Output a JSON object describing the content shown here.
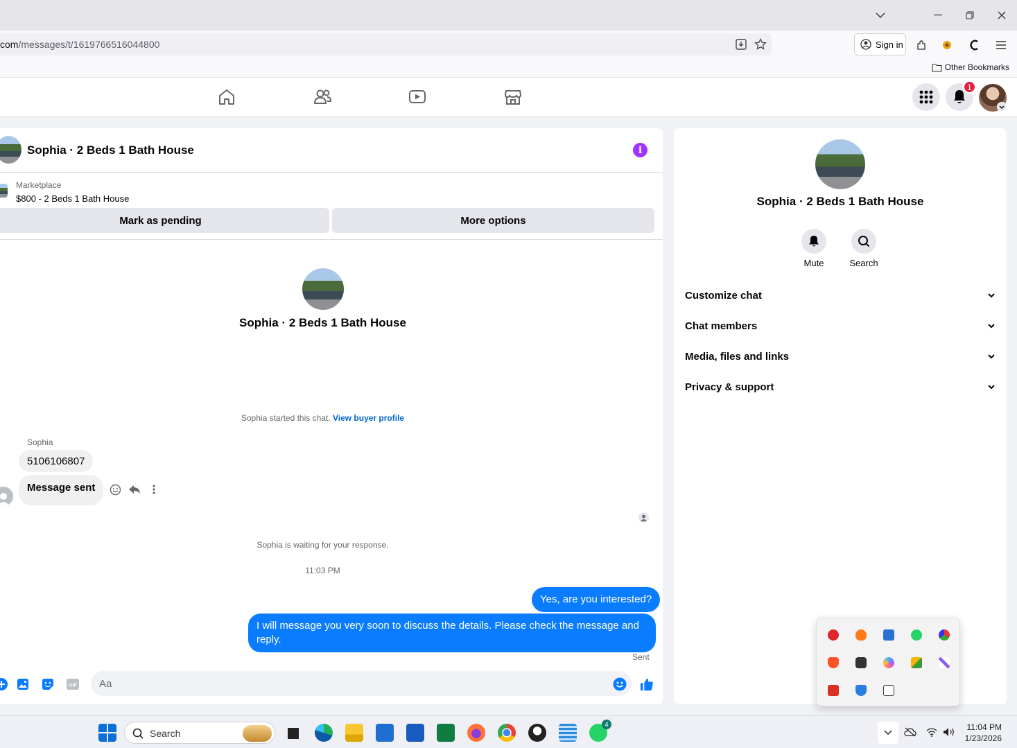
{
  "browser": {
    "url_prefix": "com",
    "url_path": "/messages/t/1619766516044800",
    "signin_label": "Sign in",
    "other_bookmarks": "Other Bookmarks"
  },
  "fb": {
    "notification_count": "1"
  },
  "chat": {
    "title": "Sophia · 2 Beds 1 Bath House",
    "marketplace_label": "Marketplace",
    "listing": "$800 - 2 Beds 1 Bath House",
    "mark_pending": "Mark as pending",
    "more_options": "More options",
    "center_name": "Sophia · 2 Beds 1 Bath House",
    "started_text": "Sophia started this chat. ",
    "view_profile": "View buyer profile",
    "sender_name": "Sophia",
    "msg_phone": "5106106807",
    "msg_sent": "Message sent",
    "waiting": "Sophia is waiting for your response.",
    "timestamp": "11:03 PM",
    "out_msg_1": "Yes, are you interested?",
    "out_msg_2": "I will message you very soon to discuss the details. Please check the message and reply.",
    "sent_status": "Sent",
    "composer_placeholder": "Aa"
  },
  "details": {
    "name": "Sophia · 2 Beds 1 Bath House",
    "mute": "Mute",
    "search": "Search",
    "sections": [
      "Customize chat",
      "Chat members",
      "Media, files and links",
      "Privacy & support"
    ]
  },
  "taskbar": {
    "search_label": "Search",
    "whatsapp_badge": "4",
    "time": "11:04 PM",
    "date": "1/23/2026"
  },
  "colors": {
    "messenger_blue": "#0a7cff",
    "link_blue": "#0064d1",
    "info_purple": "#a033ff",
    "badge_red": "#e41e3f"
  }
}
